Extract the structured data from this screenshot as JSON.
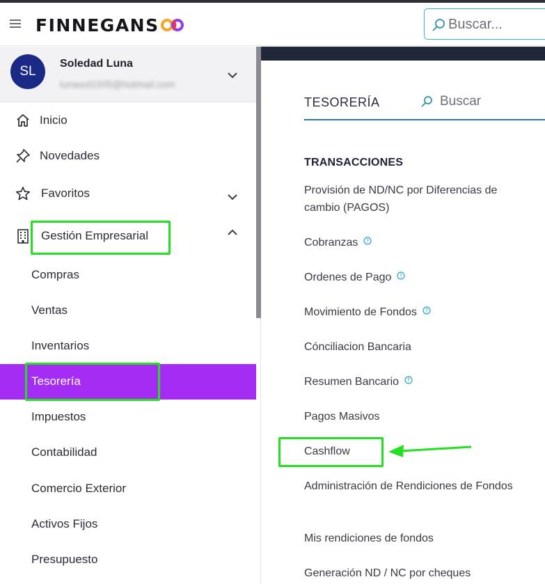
{
  "header": {
    "brand": "FINNEGANS",
    "search_placeholder": "Buscar..."
  },
  "user": {
    "initials": "SL",
    "name": "Soledad Luna",
    "email": "lunasol1505@hotmail.com"
  },
  "sidebar": {
    "items": [
      {
        "label": "Inicio",
        "icon": "home-icon"
      },
      {
        "label": "Novedades",
        "icon": "pin-icon"
      },
      {
        "label": "Favoritos",
        "icon": "star-icon"
      },
      {
        "label": "Gestión Empresarial",
        "icon": "building-icon"
      }
    ],
    "subitems": [
      {
        "label": "Compras"
      },
      {
        "label": "Ventas"
      },
      {
        "label": "Inventarios"
      },
      {
        "label": "Tesorería",
        "active": true
      },
      {
        "label": "Impuestos"
      },
      {
        "label": "Contabilidad"
      },
      {
        "label": "Comercio Exterior"
      },
      {
        "label": "Activos Fijos"
      },
      {
        "label": "Presupuesto"
      }
    ]
  },
  "main": {
    "section_title": "TESORERÍA",
    "search_placeholder": "Buscar",
    "group_title": "TRANSACCIONES",
    "links": [
      {
        "label": "Provisión de ND/NC por Diferencias de cambio (PAGOS)",
        "help": false
      },
      {
        "label": "Cobranzas",
        "help": true
      },
      {
        "label": "Ordenes de Pago",
        "help": true
      },
      {
        "label": "Movimiento de Fondos",
        "help": true
      },
      {
        "label": "Cónciliacion Bancaria",
        "help": false
      },
      {
        "label": "Resumen Bancario",
        "help": true
      },
      {
        "label": "Pagos Masivos",
        "help": false
      },
      {
        "label": "Cashflow",
        "help": false
      },
      {
        "label": "Administración de Rendiciones de Fondos",
        "help": false
      },
      {
        "label": "Mis rendiciones de fondos",
        "help": false
      },
      {
        "label": "Generación ND / NC por cheques",
        "help": false
      }
    ]
  },
  "colors": {
    "accent_active": "#a42cf3",
    "annotation_green": "#22e020",
    "search_border": "#35b3cf",
    "avatar_bg": "#1b2a86"
  }
}
